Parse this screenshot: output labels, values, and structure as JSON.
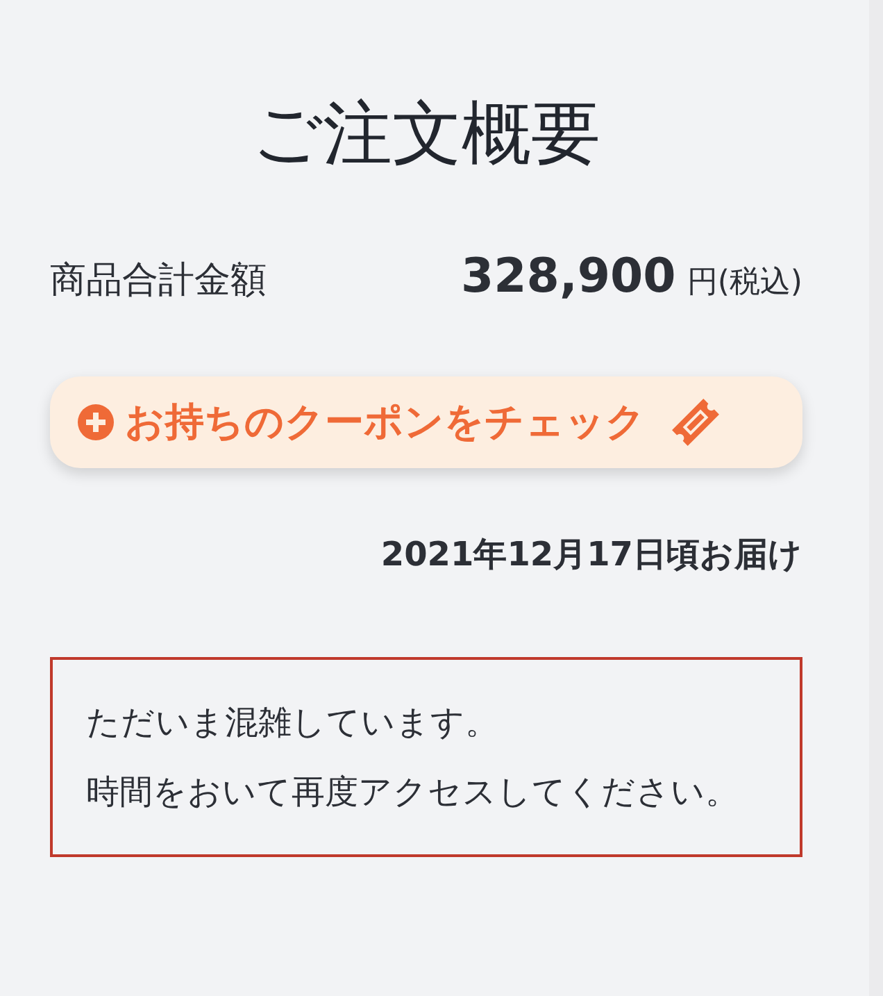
{
  "title": "ご注文概要",
  "subtotal": {
    "label": "商品合計金額",
    "amount": "328,900",
    "unit": "円(税込)"
  },
  "coupon_button": {
    "label": "お持ちのクーポンをチェック"
  },
  "delivery": "2021年12月17日頃お届け",
  "notice": {
    "lines": [
      "ただいま混雑しています。",
      "時間をおいて再度アクセスしてください。"
    ]
  }
}
